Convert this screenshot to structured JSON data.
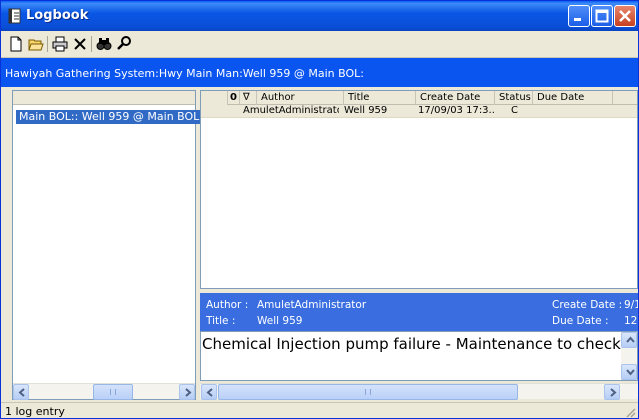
{
  "window": {
    "title": "Logbook",
    "icons": {
      "app": "notebook-icon",
      "minimize": "minimize-icon",
      "maximize": "maximize-icon",
      "close": "close-icon"
    }
  },
  "toolbar": {
    "items": [
      "new-entry-icon",
      "open-folder-icon",
      "print-icon",
      "delete-icon",
      "find-icon",
      "properties-icon"
    ]
  },
  "path": "Hawiyah Gathering System:Hwy Main Man:Well 959 @ Main BOL:",
  "tree": {
    "selected_item": "Main BOL:: Well 959 @ Main BOL"
  },
  "grid": {
    "columns": [
      "0",
      "∇",
      "Author",
      "Title",
      "Create Date",
      "Status",
      "Due Date"
    ],
    "rows": [
      {
        "author": "AmuletAdministrator",
        "title": "Well 959",
        "create_date": "17/09/03 17:3...",
        "status": "C",
        "due_date": ""
      }
    ]
  },
  "detail": {
    "author_label": "Author :",
    "author_value": "AmuletAdministrator",
    "title_label": "Title :",
    "title_value": "Well 959",
    "create_date_label": "Create Date :",
    "create_date_value": "9/1",
    "due_date_label": "Due Date :",
    "due_date_value": "12",
    "text": "Chemical Injection pump failure - Maintenance to check"
  },
  "status": "1 log entry",
  "colors": {
    "path_bar": "#0a55f0",
    "selection": "#316ac5",
    "detail_header": "#3a6ee0"
  }
}
